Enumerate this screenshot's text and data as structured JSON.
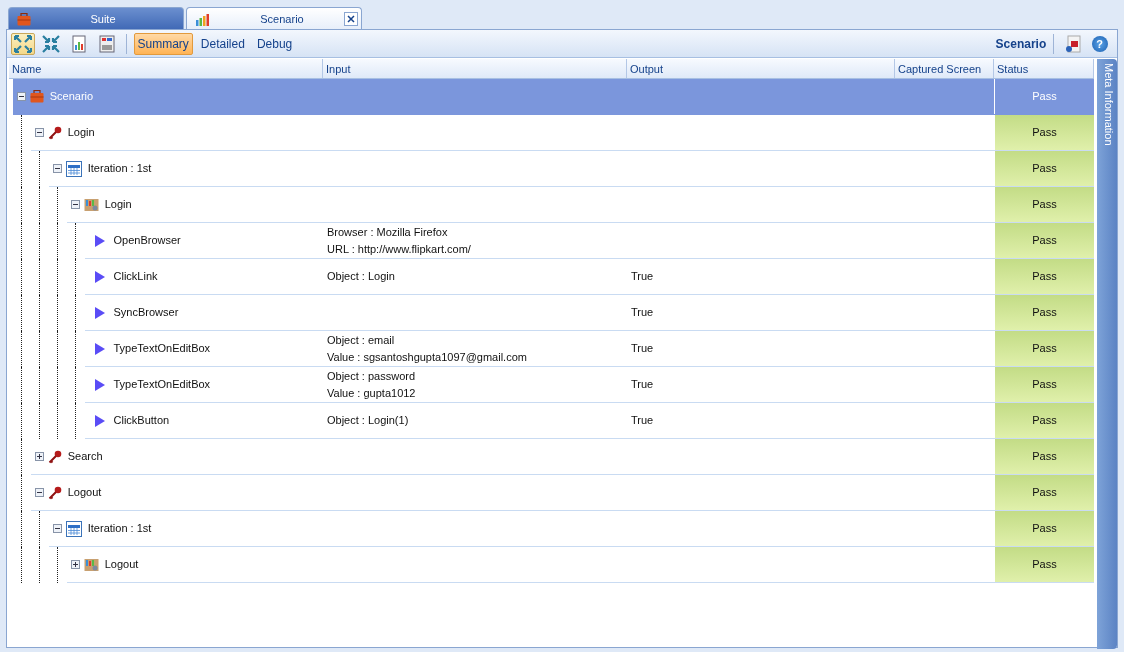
{
  "tabs": [
    {
      "label": "Suite",
      "kind": "suite",
      "selected": false,
      "closable": false
    },
    {
      "label": "Scenario",
      "kind": "scenario",
      "selected": true,
      "closable": true
    }
  ],
  "toolbar": {
    "views": [
      {
        "label": "Summary",
        "selected": true
      },
      {
        "label": "Detailed",
        "selected": false
      },
      {
        "label": "Debug",
        "selected": false
      }
    ],
    "title": "Scenario",
    "help_label": "?"
  },
  "columns": [
    "Name",
    "Input",
    "Output",
    "Captured Screen",
    "Status"
  ],
  "tree": [
    {
      "kind": "scenario",
      "name": "Scenario",
      "expanded": true,
      "selected": true,
      "status": "Pass",
      "children": [
        {
          "kind": "testcase",
          "name": "Login",
          "expanded": true,
          "selected": false,
          "status": "Pass",
          "children": [
            {
              "kind": "iteration",
              "name": "Iteration : 1st",
              "expanded": true,
              "selected": false,
              "status": "Pass",
              "children": [
                {
                  "kind": "reusable",
                  "name": "Login",
                  "expanded": true,
                  "selected": false,
                  "status": "Pass",
                  "children": [
                    {
                      "kind": "step",
                      "name": "OpenBrowser",
                      "input": [
                        "Browser : Mozilla Firefox",
                        "URL : http://www.flipkart.com/"
                      ],
                      "selected": false,
                      "status": "Pass"
                    },
                    {
                      "kind": "step",
                      "name": "ClickLink",
                      "input": [
                        "Object : Login"
                      ],
                      "output": "True",
                      "selected": false,
                      "status": "Pass"
                    },
                    {
                      "kind": "step",
                      "name": "SyncBrowser",
                      "output": "True",
                      "selected": false,
                      "status": "Pass"
                    },
                    {
                      "kind": "step",
                      "name": "TypeTextOnEditBox",
                      "input": [
                        "Object : email",
                        "Value : sgsantoshgupta1097@gmail.com"
                      ],
                      "output": "True",
                      "selected": false,
                      "status": "Pass"
                    },
                    {
                      "kind": "step",
                      "name": "TypeTextOnEditBox",
                      "input": [
                        "Object : password",
                        "Value : gupta1012"
                      ],
                      "output": "True",
                      "selected": false,
                      "status": "Pass"
                    },
                    {
                      "kind": "step",
                      "name": "ClickButton",
                      "input": [
                        "Object : Login(1)"
                      ],
                      "output": "True",
                      "selected": false,
                      "status": "Pass"
                    }
                  ]
                }
              ]
            }
          ]
        },
        {
          "kind": "testcase",
          "name": "Search",
          "expanded": false,
          "selected": false,
          "status": "Pass"
        },
        {
          "kind": "testcase",
          "name": "Logout",
          "expanded": true,
          "selected": false,
          "status": "Pass",
          "children": [
            {
              "kind": "iteration",
              "name": "Iteration : 1st",
              "expanded": true,
              "selected": false,
              "status": "Pass",
              "children": [
                {
                  "kind": "reusable",
                  "name": "Logout",
                  "expanded": false,
                  "selected": false,
                  "status": "Pass"
                }
              ]
            }
          ]
        }
      ]
    }
  ],
  "side_tab": "Meta Information"
}
